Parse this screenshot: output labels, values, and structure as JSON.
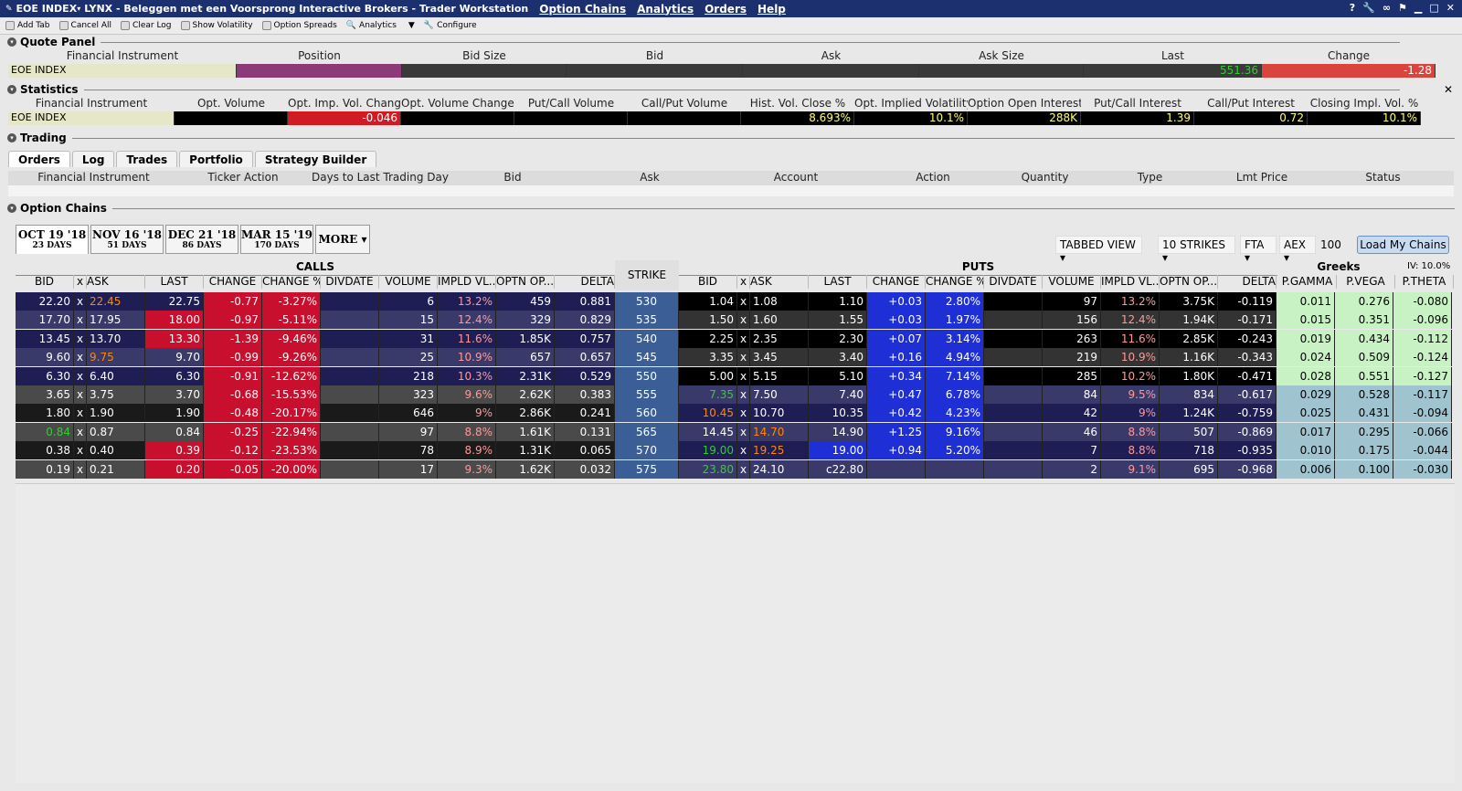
{
  "titlebar": {
    "window": "EOE INDEX",
    "title": "LYNX - Beleggen met een Voorsprong Interactive Brokers - Trader Workstation",
    "menus": [
      "Option Chains",
      "Analytics",
      "Orders",
      "Help"
    ]
  },
  "toolbar": [
    "Add Tab",
    "Cancel All",
    "Clear Log",
    "Show Volatility",
    "Option Spreads",
    "Analytics",
    "Configure"
  ],
  "quote_panel": {
    "title": "Quote Panel",
    "headers": [
      "Financial Instrument",
      "Position",
      "Bid Size",
      "Bid",
      "Ask",
      "Ask Size",
      "Last",
      "Change"
    ],
    "instrument": "EOE INDEX",
    "last": "551.36",
    "change": "-1.28"
  },
  "statistics": {
    "title": "Statistics",
    "headers": [
      "Financial Instrument",
      "Opt. Volume",
      "Opt. Imp. Vol. Change",
      "Opt. Volume Change %",
      "Put/Call Volume",
      "Call/Put Volume",
      "Hist. Vol. Close %",
      "Opt. Implied Volatility %",
      "Option Open Interest",
      "Put/Call Interest",
      "Call/Put Interest",
      "Closing Impl. Vol. %"
    ],
    "instrument": "EOE INDEX",
    "imp_vol_change": "-0.046",
    "hist_vol": "8.693%",
    "implied_vol": "10.1%",
    "open_interest": "288K",
    "put_call_interest": "1.39",
    "call_put_interest": "0.72",
    "closing_impl_vol": "10.1%"
  },
  "trading": {
    "title": "Trading",
    "tabs": [
      "Orders",
      "Log",
      "Trades",
      "Portfolio",
      "Strategy Builder"
    ],
    "headers": [
      "Financial Instrument",
      "Ticker Action",
      "Days to Last Trading Day",
      "Bid",
      "Ask",
      "Account",
      "Action",
      "Quantity",
      "Type",
      "Lmt Price",
      "Status"
    ]
  },
  "option_chains": {
    "title": "Option Chains",
    "expiries": [
      {
        "date": "OCT 19 '18",
        "days": "23 DAYS"
      },
      {
        "date": "NOV 16 '18",
        "days": "51 DAYS"
      },
      {
        "date": "DEC 21 '18",
        "days": "86 DAYS"
      },
      {
        "date": "MAR 15 '19",
        "days": "170 DAYS"
      }
    ],
    "more": "MORE",
    "view": "TABBED VIEW",
    "strikes": "10 STRIKES",
    "exchange": "FTA",
    "market": "AEX",
    "multiplier": "100",
    "load_button": "Load My Chains",
    "calls_label": "CALLS",
    "puts_label": "PUTS",
    "strike_label": "STRIKE",
    "greeks_label": "Greeks",
    "iv_label": "IV: 10.0%",
    "call_headers": [
      "BID",
      "x",
      "ASK",
      "LAST",
      "CHANGE",
      "CHANGE %",
      "DIVDATE",
      "VOLUME",
      "IMPLD VL...",
      "OPTN OP...",
      "DELTA"
    ],
    "put_headers": [
      "BID",
      "x",
      "ASK",
      "LAST",
      "CHANGE",
      "CHANGE %",
      "DIVDATE",
      "VOLUME",
      "IMPLD VL...",
      "OPTN OP...",
      "DELTA"
    ],
    "greek_headers": [
      "P.GAMMA",
      "P.VEGA",
      "P.THETA"
    ],
    "rows": [
      {
        "strike": "530",
        "c": [
          "22.20",
          "x",
          "22.45",
          "22.75",
          "-0.77",
          "-3.27%",
          "",
          "6",
          "13.2%",
          "459",
          "0.881"
        ],
        "p": [
          "1.04",
          "x",
          "1.08",
          "1.10",
          "+0.03",
          "2.80%",
          "",
          "97",
          "13.2%",
          "3.75K",
          "-0.119"
        ],
        "g": [
          "0.011",
          "0.276",
          "-0.080"
        ]
      },
      {
        "strike": "535",
        "c": [
          "17.70",
          "x",
          "17.95",
          "18.00",
          "-0.97",
          "-5.11%",
          "",
          "15",
          "12.4%",
          "329",
          "0.829"
        ],
        "p": [
          "1.50",
          "x",
          "1.60",
          "1.55",
          "+0.03",
          "1.97%",
          "",
          "156",
          "12.4%",
          "1.94K",
          "-0.171"
        ],
        "g": [
          "0.015",
          "0.351",
          "-0.096"
        ]
      },
      {
        "strike": "540",
        "c": [
          "13.45",
          "x",
          "13.70",
          "13.30",
          "-1.39",
          "-9.46%",
          "",
          "31",
          "11.6%",
          "1.85K",
          "0.757"
        ],
        "p": [
          "2.25",
          "x",
          "2.35",
          "2.30",
          "+0.07",
          "3.14%",
          "",
          "263",
          "11.6%",
          "2.85K",
          "-0.243"
        ],
        "g": [
          "0.019",
          "0.434",
          "-0.112"
        ]
      },
      {
        "strike": "545",
        "c": [
          "9.60",
          "x",
          "9.75",
          "9.70",
          "-0.99",
          "-9.26%",
          "",
          "25",
          "10.9%",
          "657",
          "0.657"
        ],
        "p": [
          "3.35",
          "x",
          "3.45",
          "3.40",
          "+0.16",
          "4.94%",
          "",
          "219",
          "10.9%",
          "1.16K",
          "-0.343"
        ],
        "g": [
          "0.024",
          "0.509",
          "-0.124"
        ]
      },
      {
        "strike": "550",
        "c": [
          "6.30",
          "x",
          "6.40",
          "6.30",
          "-0.91",
          "-12.62%",
          "",
          "218",
          "10.3%",
          "2.31K",
          "0.529"
        ],
        "p": [
          "5.00",
          "x",
          "5.15",
          "5.10",
          "+0.34",
          "7.14%",
          "",
          "285",
          "10.2%",
          "1.80K",
          "-0.471"
        ],
        "g": [
          "0.028",
          "0.551",
          "-0.127"
        ]
      },
      {
        "strike": "555",
        "c": [
          "3.65",
          "x",
          "3.75",
          "3.70",
          "-0.68",
          "-15.53%",
          "",
          "323",
          "9.6%",
          "2.62K",
          "0.383"
        ],
        "p": [
          "7.35",
          "x",
          "7.50",
          "7.40",
          "+0.47",
          "6.78%",
          "",
          "84",
          "9.5%",
          "834",
          "-0.617"
        ],
        "g": [
          "0.029",
          "0.528",
          "-0.117"
        ]
      },
      {
        "strike": "560",
        "c": [
          "1.80",
          "x",
          "1.90",
          "1.90",
          "-0.48",
          "-20.17%",
          "",
          "646",
          "9%",
          "2.86K",
          "0.241"
        ],
        "p": [
          "10.45",
          "x",
          "10.70",
          "10.35",
          "+0.42",
          "4.23%",
          "",
          "42",
          "9%",
          "1.24K",
          "-0.759"
        ],
        "g": [
          "0.025",
          "0.431",
          "-0.094"
        ]
      },
      {
        "strike": "565",
        "c": [
          "0.84",
          "x",
          "0.87",
          "0.84",
          "-0.25",
          "-22.94%",
          "",
          "97",
          "8.8%",
          "1.61K",
          "0.131"
        ],
        "p": [
          "14.45",
          "x",
          "14.70",
          "14.90",
          "+1.25",
          "9.16%",
          "",
          "46",
          "8.8%",
          "507",
          "-0.869"
        ],
        "g": [
          "0.017",
          "0.295",
          "-0.066"
        ]
      },
      {
        "strike": "570",
        "c": [
          "0.38",
          "x",
          "0.40",
          "0.39",
          "-0.12",
          "-23.53%",
          "",
          "78",
          "8.9%",
          "1.31K",
          "0.065"
        ],
        "p": [
          "19.00",
          "x",
          "19.25",
          "19.00",
          "+0.94",
          "5.20%",
          "",
          "7",
          "8.8%",
          "718",
          "-0.935"
        ],
        "g": [
          "0.010",
          "0.175",
          "-0.044"
        ]
      },
      {
        "strike": "575",
        "c": [
          "0.19",
          "x",
          "0.21",
          "0.20",
          "-0.05",
          "-20.00%",
          "",
          "17",
          "9.3%",
          "1.62K",
          "0.032"
        ],
        "p": [
          "23.80",
          "x",
          "24.10",
          "c22.80",
          "",
          "",
          "",
          "2",
          "9.1%",
          "695",
          "-0.968"
        ],
        "g": [
          "0.006",
          "0.100",
          "-0.030"
        ]
      }
    ]
  },
  "colors": {
    "titlebar": "#1c2f6e",
    "call_bg": "#1a1a4a",
    "put_bg": "#000000",
    "red": "#cc1b2b",
    "blue": "#1f2fd6",
    "strike": "#3a5e95",
    "greek": "#c9f2c4"
  }
}
